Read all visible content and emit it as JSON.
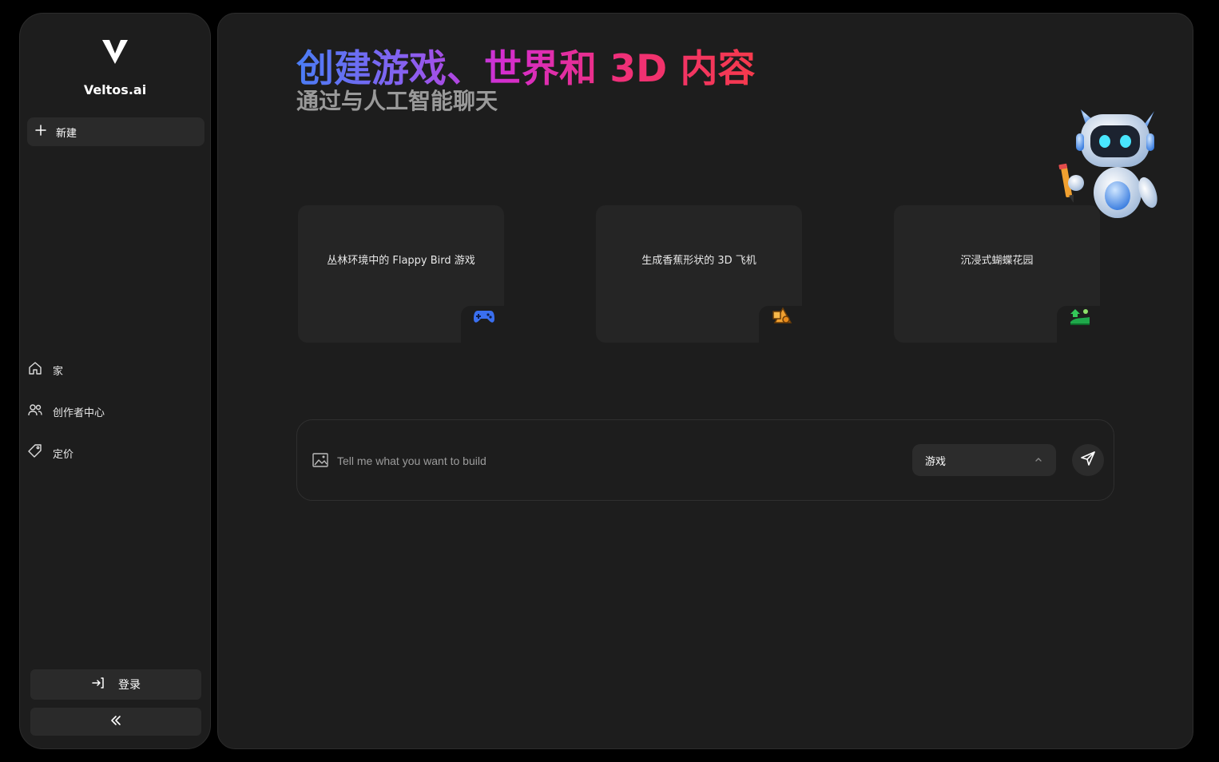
{
  "sidebar": {
    "brand": "Veltos.ai",
    "new_label": "新建",
    "nav": [
      {
        "label": "家",
        "icon": "home-icon"
      },
      {
        "label": "创作者中心",
        "icon": "users-icon"
      },
      {
        "label": "定价",
        "icon": "tag-icon"
      }
    ],
    "login_label": "登录",
    "collapse_label": "«"
  },
  "main": {
    "headline": "创建游戏、世界和 3D 内容",
    "subheadline": "通过与人工智能聊天",
    "cards": [
      {
        "text": "丛林环境中的 Flappy Bird 游戏",
        "icon": "gamepad-icon"
      },
      {
        "text": "生成香蕉形状的 3D 飞机",
        "icon": "3d-shapes-icon"
      },
      {
        "text": "沉浸式蝴蝶花园",
        "icon": "landscape-icon"
      }
    ],
    "prompt": {
      "placeholder": "Tell me what you want to build",
      "value": "",
      "selected_type": "游戏"
    }
  },
  "colors": {
    "background": "#000000",
    "panel": "#1d1d1d",
    "button": "#2a2a2a",
    "gradient_start": "#4a7df5",
    "gradient_mid": "#d42ed0",
    "gradient_end": "#f63a4c",
    "subheadline": "#9a9a9a"
  }
}
